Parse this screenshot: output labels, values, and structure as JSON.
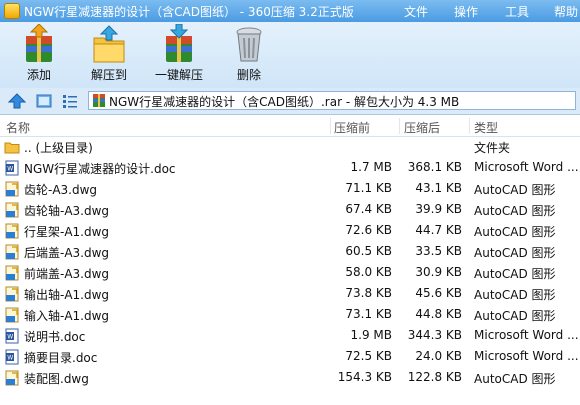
{
  "window": {
    "title": "NGW行星减速器的设计（含CAD图纸） - 360压缩 3.2正式版",
    "menus": [
      "文件",
      "操作",
      "工具",
      "帮助"
    ]
  },
  "toolbar": {
    "add": "添加",
    "extract_to": "解压到",
    "one_click_extract": "一键解压",
    "delete": "删除"
  },
  "address": {
    "path": "NGW行星减速器的设计（含CAD图纸）.rar - 解包大小为 4.3 MB"
  },
  "columns": {
    "name": "名称",
    "compressed_before": "压缩前",
    "compressed_after": "压缩后",
    "type": "类型"
  },
  "rows": [
    {
      "name": ".. (上级目录)",
      "size": "",
      "comp": "",
      "type": "文件夹",
      "icon": "folder-icon"
    },
    {
      "name": "NGW行星减速器的设计.doc",
      "size": "1.7 MB",
      "comp": "368.1 KB",
      "type": "Microsoft Word ...",
      "icon": "word-doc-icon"
    },
    {
      "name": "齿轮-A3.dwg",
      "size": "71.1 KB",
      "comp": "43.1 KB",
      "type": "AutoCAD 图形",
      "icon": "dwg-file-icon"
    },
    {
      "name": "齿轮轴-A3.dwg",
      "size": "67.4 KB",
      "comp": "39.9 KB",
      "type": "AutoCAD 图形",
      "icon": "dwg-file-icon"
    },
    {
      "name": "行星架-A1.dwg",
      "size": "72.6 KB",
      "comp": "44.7 KB",
      "type": "AutoCAD 图形",
      "icon": "dwg-file-icon"
    },
    {
      "name": "后端盖-A3.dwg",
      "size": "60.5 KB",
      "comp": "33.5 KB",
      "type": "AutoCAD 图形",
      "icon": "dwg-file-icon"
    },
    {
      "name": "前端盖-A3.dwg",
      "size": "58.0 KB",
      "comp": "30.9 KB",
      "type": "AutoCAD 图形",
      "icon": "dwg-file-icon"
    },
    {
      "name": "输出轴-A1.dwg",
      "size": "73.8 KB",
      "comp": "45.6 KB",
      "type": "AutoCAD 图形",
      "icon": "dwg-file-icon"
    },
    {
      "name": "输入轴-A1.dwg",
      "size": "73.1 KB",
      "comp": "44.8 KB",
      "type": "AutoCAD 图形",
      "icon": "dwg-file-icon"
    },
    {
      "name": "说明书.doc",
      "size": "1.9 MB",
      "comp": "344.3 KB",
      "type": "Microsoft Word ...",
      "icon": "word-doc-icon"
    },
    {
      "name": "摘要目录.doc",
      "size": "72.5 KB",
      "comp": "24.0 KB",
      "type": "Microsoft Word ...",
      "icon": "word-doc-icon"
    },
    {
      "name": "装配图.dwg",
      "size": "154.3 KB",
      "comp": "122.8 KB",
      "type": "AutoCAD 图形",
      "icon": "dwg-file-icon"
    }
  ]
}
